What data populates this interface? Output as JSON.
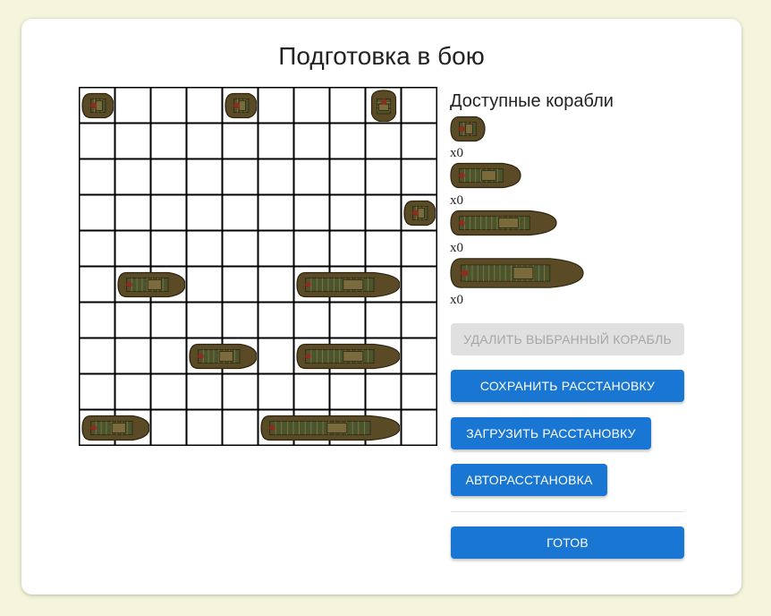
{
  "title": "Подготовка в бою",
  "board": {
    "rows": 10,
    "cols": 10,
    "ships": [
      {
        "size": 1,
        "row": 0,
        "col": 0,
        "orientation": "horizontal"
      },
      {
        "size": 1,
        "row": 0,
        "col": 4,
        "orientation": "horizontal"
      },
      {
        "size": 1,
        "row": 0,
        "col": 8,
        "orientation": "vertical"
      },
      {
        "size": 1,
        "row": 3,
        "col": 9,
        "orientation": "horizontal"
      },
      {
        "size": 2,
        "row": 5,
        "col": 1,
        "orientation": "horizontal"
      },
      {
        "size": 3,
        "row": 5,
        "col": 6,
        "orientation": "horizontal"
      },
      {
        "size": 2,
        "row": 7,
        "col": 3,
        "orientation": "horizontal"
      },
      {
        "size": 3,
        "row": 7,
        "col": 6,
        "orientation": "horizontal"
      },
      {
        "size": 2,
        "row": 9,
        "col": 0,
        "orientation": "horizontal"
      },
      {
        "size": 4,
        "row": 9,
        "col": 5,
        "orientation": "horizontal"
      }
    ]
  },
  "sidebar": {
    "title": "Доступные корабли",
    "available": [
      {
        "size": 1,
        "count": "x0"
      },
      {
        "size": 2,
        "count": "x0"
      },
      {
        "size": 3,
        "count": "x0"
      },
      {
        "size": 4,
        "count": "x0"
      }
    ],
    "buttons": {
      "delete": "Удалить выбранный корабль",
      "save": "Сохранить расстановку",
      "load": "Загрузить расстановку",
      "auto": "Авторасстановка",
      "ready": "Готов"
    }
  },
  "colors": {
    "primary": "#1976d2",
    "disabled": "#e0e0e0",
    "hull": "#5a4a26",
    "deck": "#4a5530",
    "background": "#f5f4dc"
  }
}
